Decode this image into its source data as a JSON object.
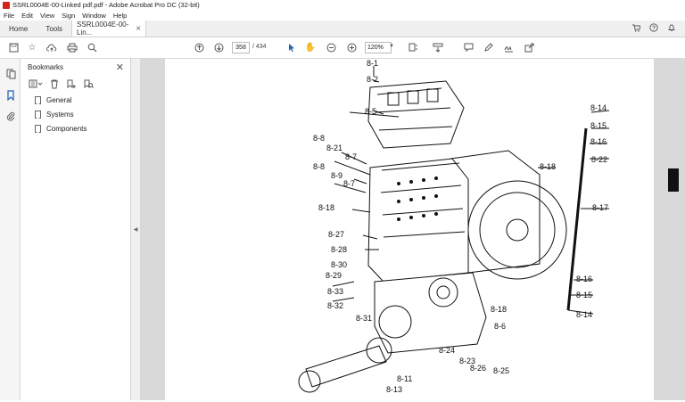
{
  "window": {
    "title": "SSRL0004E-00-Linked pdf.pdf - Adobe Acrobat Pro DC (32-bit)"
  },
  "menu": [
    "File",
    "Edit",
    "View",
    "Sign",
    "Window",
    "Help"
  ],
  "tabs": {
    "home": "Home",
    "tools": "Tools",
    "document": "SSRL0004E-00-Lin...",
    "close": "×"
  },
  "toolbar": {
    "page_current": "358",
    "page_total": "/ 434",
    "zoom": "120%"
  },
  "bookmarks": {
    "title": "Bookmarks",
    "items": [
      {
        "label": "General"
      },
      {
        "label": "Systems"
      },
      {
        "label": "Components"
      }
    ]
  },
  "diagram": {
    "callouts": [
      "8-1",
      "8-2",
      "8-5",
      "8-8",
      "8-21",
      "8-7",
      "8-8",
      "8-9",
      "8-7",
      "8-18",
      "8-27",
      "8-28",
      "8-30",
      "8-29",
      "8-33",
      "8-32",
      "8-31",
      "8-14",
      "8-15",
      "8-16",
      "8-18",
      "8-22",
      "8-17",
      "8-16",
      "8-15",
      "8-14",
      "8-18",
      "8-6",
      "8-24",
      "8-23",
      "8-26",
      "8-25",
      "8-11",
      "8-13"
    ]
  }
}
